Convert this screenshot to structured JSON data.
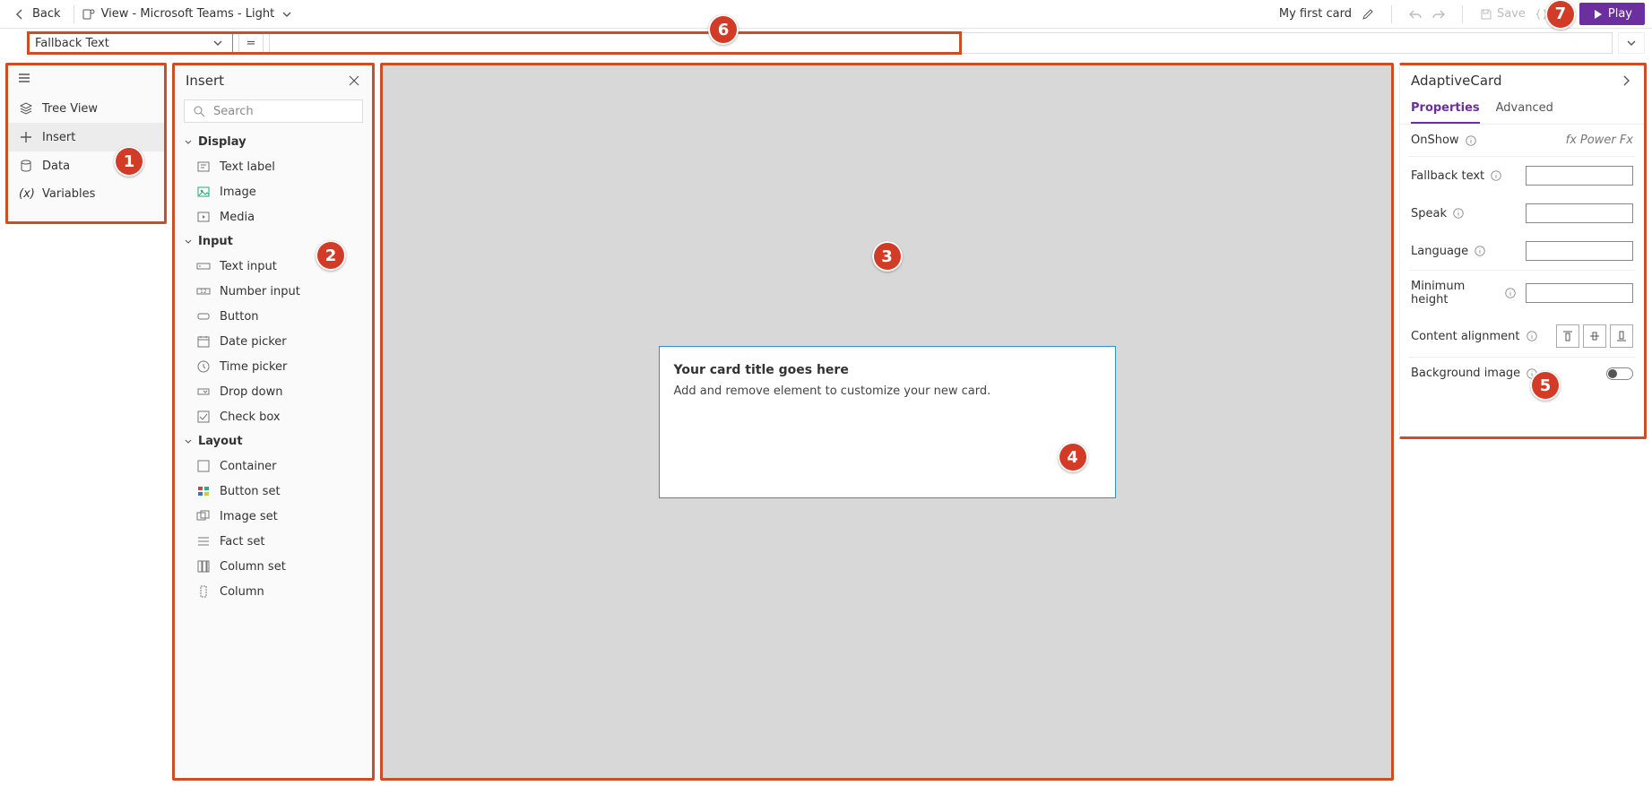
{
  "appbar": {
    "back": "Back",
    "view_label": "View - Microsoft Teams - Light",
    "card_name": "My first card",
    "save": "Save",
    "play": "Play"
  },
  "formula": {
    "selected_property": "Fallback Text"
  },
  "nav": {
    "items": [
      {
        "icon": "layers",
        "label": "Tree View"
      },
      {
        "icon": "plus",
        "label": "Insert"
      },
      {
        "icon": "db",
        "label": "Data"
      },
      {
        "icon": "var",
        "label": "Variables"
      }
    ]
  },
  "insert": {
    "title": "Insert",
    "search_placeholder": "Search",
    "groups": [
      {
        "name": "Display",
        "items": [
          "Text label",
          "Image",
          "Media"
        ]
      },
      {
        "name": "Input",
        "items": [
          "Text input",
          "Number input",
          "Button",
          "Date picker",
          "Time picker",
          "Drop down",
          "Check box"
        ]
      },
      {
        "name": "Layout",
        "items": [
          "Container",
          "Button set",
          "Image set",
          "Fact set",
          "Column set",
          "Column"
        ]
      }
    ]
  },
  "canvas_card": {
    "title": "Your card title goes here",
    "body": "Add and remove element to customize your new card."
  },
  "props": {
    "title": "AdaptiveCard",
    "tabs": [
      "Properties",
      "Advanced"
    ],
    "onshow_label": "OnShow",
    "powerfx_label": "Power Fx",
    "rows": {
      "fallback": "Fallback text",
      "speak": "Speak",
      "lang": "Language",
      "minh": "Minimum height",
      "align": "Content alignment",
      "bg": "Background image"
    }
  },
  "bubbles": [
    "1",
    "2",
    "3",
    "4",
    "5",
    "6",
    "7"
  ]
}
